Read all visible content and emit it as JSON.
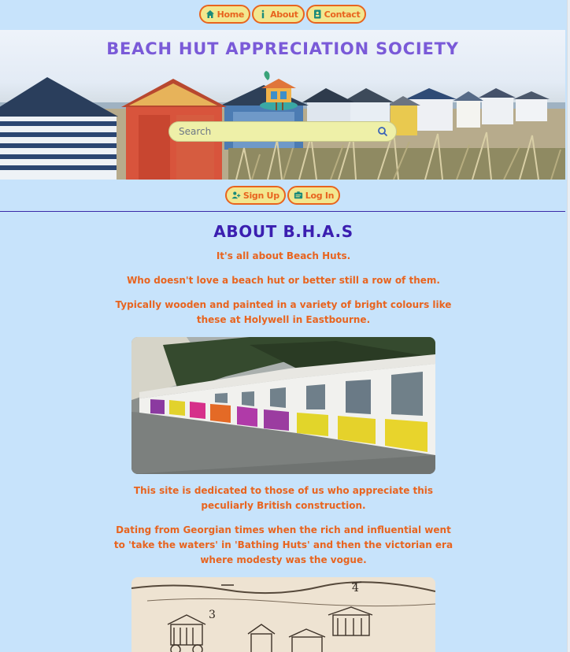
{
  "nav": {
    "items": [
      {
        "label": "Home",
        "icon": "home-icon"
      },
      {
        "label": "About",
        "icon": "info-icon"
      },
      {
        "label": "Contact",
        "icon": "contact-icon"
      }
    ]
  },
  "hero": {
    "title": "BEACH HUT APPRECIATION SOCIETY",
    "search_placeholder": "Search"
  },
  "auth": {
    "signup_label": "Sign Up",
    "login_label": "Log In"
  },
  "about": {
    "heading": "ABOUT B.H.A.S",
    "p1": "It's all about Beach Huts.",
    "p2": "Who doesn't love a beach hut or better still a row of them.",
    "p3": "Typically wooden and painted in a variety of bright colours like these at Holywell in Eastbourne.",
    "p4": "This site is dedicated to those of us who appreciate this peculiarly British construction.",
    "p5": "Dating from Georgian times when the rich and influential went to 'take the waters' in 'Bathing Huts' and then the victorian era where modesty was the vogue."
  },
  "colors": {
    "background": "#c7e3fb",
    "accent": "#e8641f",
    "heading": "#3b1fb0",
    "title": "#7a5ad8",
    "pill": "#f2e78f"
  }
}
